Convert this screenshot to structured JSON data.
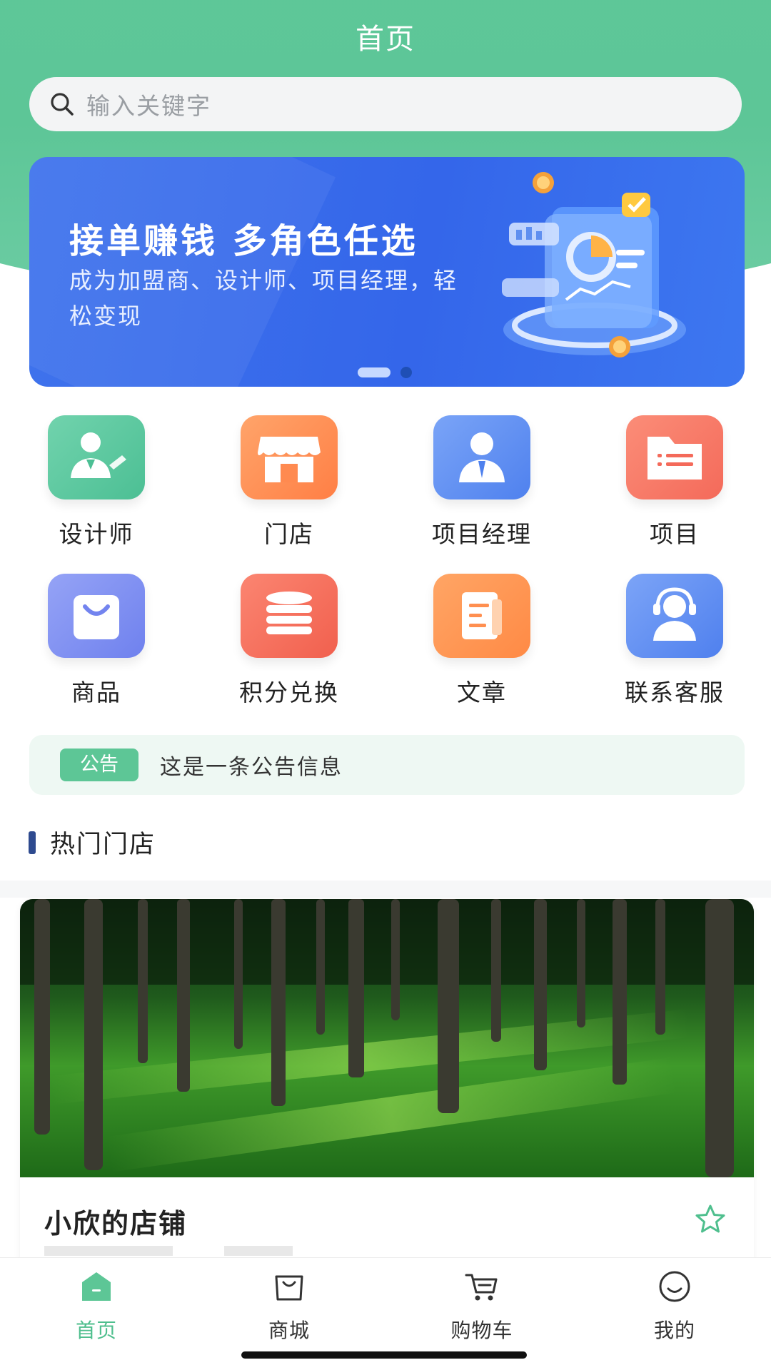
{
  "header": {
    "title": "首页"
  },
  "search": {
    "placeholder": "输入关键字",
    "icon": "search-icon"
  },
  "banner": {
    "title": "接单赚钱 多角色任选",
    "subtitle": "成为加盟商、设计师、项目经理，轻松变现",
    "slide_count": 2,
    "active_slide": 1
  },
  "menu": {
    "items": [
      {
        "label": "设计师",
        "icon": "designer-icon",
        "color": "#5ccaa2"
      },
      {
        "label": "门店",
        "icon": "store-icon",
        "color": "#ff8f55"
      },
      {
        "label": "项目经理",
        "icon": "manager-icon",
        "color": "#5d8ef3"
      },
      {
        "label": "项目",
        "icon": "folder-icon",
        "color": "#f97766"
      },
      {
        "label": "商品",
        "icon": "bag-icon",
        "color": "#7f8ff2"
      },
      {
        "label": "积分兑换",
        "icon": "coins-icon",
        "color": "#f6735f"
      },
      {
        "label": "文章",
        "icon": "article-icon",
        "color": "#ff9550"
      },
      {
        "label": "联系客服",
        "icon": "support-icon",
        "color": "#5d8ff3"
      }
    ]
  },
  "notice": {
    "badge": "公告",
    "text": "这是一条公告信息"
  },
  "hot_stores": {
    "title": "热门门店",
    "stores": [
      {
        "name": "小欣的店铺",
        "favorite_icon": "star-outline-icon"
      }
    ]
  },
  "tabbar": {
    "tabs": [
      {
        "label": "首页",
        "icon": "home-icon",
        "active": true
      },
      {
        "label": "商城",
        "icon": "shop-icon",
        "active": false
      },
      {
        "label": "购物车",
        "icon": "cart-icon",
        "active": false
      },
      {
        "label": "我的",
        "icon": "profile-icon",
        "active": false
      }
    ]
  },
  "colors": {
    "primary_green": "#5dc696",
    "banner_blue": "#3466ea",
    "active_tab": "#4fbf8e"
  }
}
